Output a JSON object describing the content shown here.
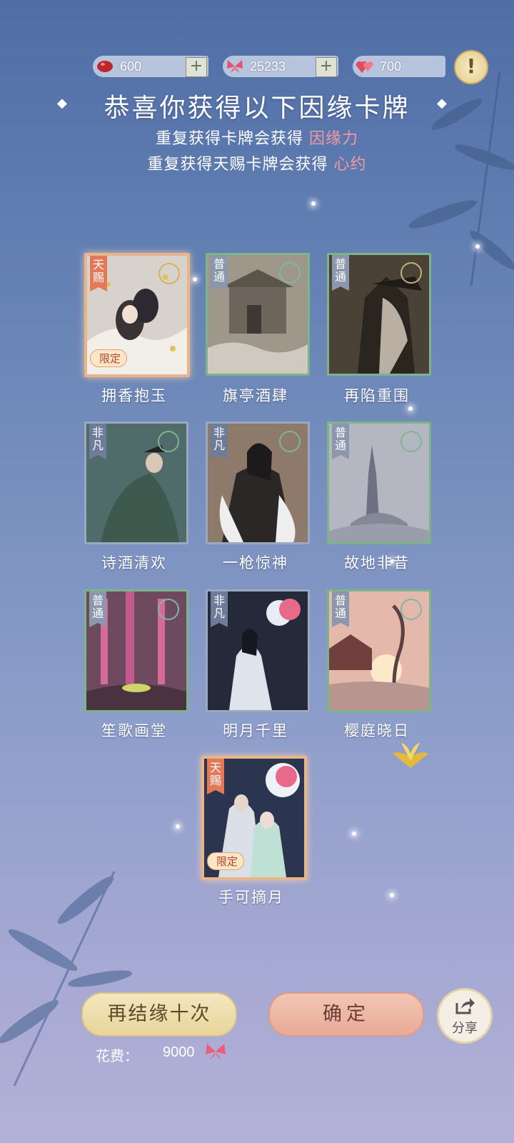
{
  "currencies": [
    {
      "icon": "red-bean-icon",
      "value": "600"
    },
    {
      "icon": "butterfly-icon",
      "value": "25233"
    },
    {
      "icon": "double-heart-icon",
      "value": "700"
    }
  ],
  "alert_symbol": "!",
  "title": "恭喜你获得以下因缘卡牌",
  "subtitle1": {
    "text": "重复获得卡牌会获得 ",
    "highlight": "因缘力"
  },
  "subtitle2": {
    "text": "重复获得天赐卡牌会获得 ",
    "highlight": "心约"
  },
  "cards": [
    {
      "name": "拥香抱玉",
      "rarity": "天赐",
      "limited": "限定"
    },
    {
      "name": "旗亭酒肆",
      "rarity": "普通"
    },
    {
      "name": "再陷重围",
      "rarity": "普通"
    },
    {
      "name": "诗酒清欢",
      "rarity": "非凡"
    },
    {
      "name": "一枪惊神",
      "rarity": "非凡"
    },
    {
      "name": "故地非昔",
      "rarity": "普通"
    },
    {
      "name": "笙歌画堂",
      "rarity": "普通"
    },
    {
      "name": "明月千里",
      "rarity": "非凡"
    },
    {
      "name": "樱庭晓日",
      "rarity": "普通"
    },
    {
      "name": "手可摘月",
      "rarity": "天赐",
      "limited": "限定"
    }
  ],
  "buttons": {
    "again": "再结缘十次",
    "confirm": "确定",
    "share": "分享"
  },
  "cost": {
    "label": "花费：",
    "value": "9000"
  },
  "colors": {
    "highlight": "#f29aa4",
    "common_border": "#7bb587",
    "rare_border": "#9aa9c1",
    "limited_border": "#e8b489"
  }
}
